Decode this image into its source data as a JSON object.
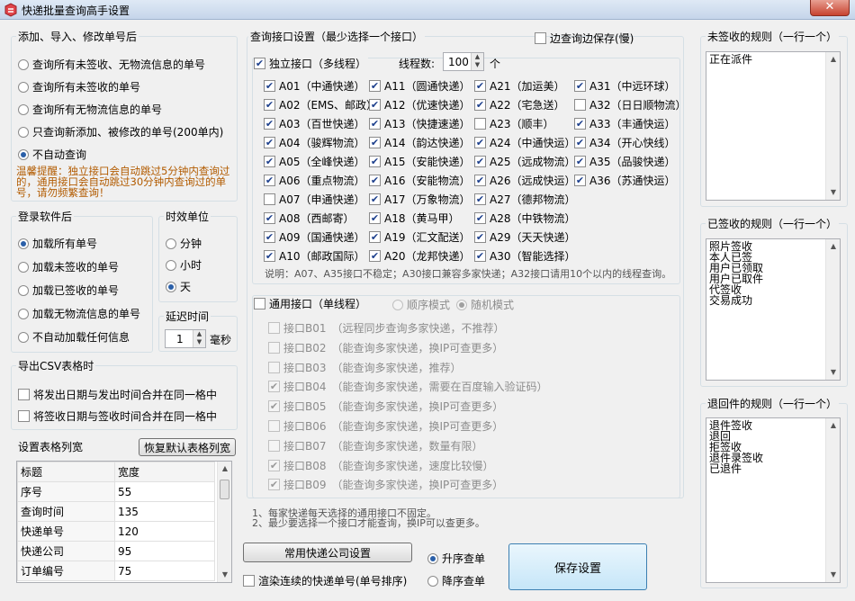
{
  "window": {
    "title": "快递批量查询高手设置",
    "close": "✕"
  },
  "add_group": {
    "title": "添加、导入、修改单号后",
    "options": [
      "查询所有未签收、无物流信息的单号",
      "查询所有未签收的单号",
      "查询所有无物流信息的单号",
      "只查询新添加、被修改的单号(200单内)",
      "不自动查询"
    ],
    "selected": 4,
    "warning": "温馨提醒：独立接口会自动跳过5分钟内查询过的，通用接口会自动跳过30分钟内查询过的单号，请勿频繁查询！"
  },
  "login_group": {
    "title": "登录软件后",
    "options": [
      "加载所有单号",
      "加载未签收的单号",
      "加载已签收的单号",
      "加载无物流信息的单号",
      "不自动加载任何信息"
    ],
    "selected": 0
  },
  "time_unit": {
    "title": "时效单位",
    "options": [
      "分钟",
      "小时",
      "天"
    ],
    "selected": 2
  },
  "delay": {
    "title": "延迟时间",
    "value": "1",
    "unit": "毫秒"
  },
  "csv_group": {
    "title": "导出CSV表格时",
    "options": [
      "将发出日期与发出时间合并在同一格中",
      "将签收日期与签收时间合并在同一格中"
    ]
  },
  "column_width": {
    "title": "设置表格列宽",
    "reset_button": "恢复默认表格列宽",
    "headers": [
      "标题",
      "宽度"
    ],
    "rows": [
      [
        "序号",
        "55"
      ],
      [
        "查询时间",
        "135"
      ],
      [
        "快递单号",
        "120"
      ],
      [
        "快递公司",
        "95"
      ],
      [
        "订单编号",
        "75"
      ]
    ]
  },
  "query_group": {
    "title": "查询接口设置（最少选择一个接口）",
    "save_while_query": "边查询边保存(慢)",
    "independent_label": "独立接口（多线程）",
    "thread_label": "线程数:",
    "thread_value": "100",
    "thread_unit": "个",
    "col1": [
      [
        "A01（中通快递）",
        true
      ],
      [
        "A02（EMS、邮政）",
        true
      ],
      [
        "A03（百世快递）",
        true
      ],
      [
        "A04（骏辉物流）",
        true
      ],
      [
        "A05（全峰快递）",
        true
      ],
      [
        "A06（重点物流）",
        true
      ],
      [
        "A07（申通快递）",
        false
      ],
      [
        "A08（西邮寄）",
        true
      ],
      [
        "A09（国通快递）",
        true
      ],
      [
        "A10（邮政国际）",
        true
      ]
    ],
    "col2": [
      [
        "A11（圆通快递）",
        true
      ],
      [
        "A12（优速快递）",
        true
      ],
      [
        "A13（快捷速递）",
        true
      ],
      [
        "A14（韵达快递）",
        true
      ],
      [
        "A15（安能快递）",
        true
      ],
      [
        "A16（安能物流）",
        true
      ],
      [
        "A17（万象物流）",
        true
      ],
      [
        "A18（黄马甲）",
        true
      ],
      [
        "A19（汇文配送）",
        true
      ],
      [
        "A20（龙邦快递）",
        true
      ]
    ],
    "col3": [
      [
        "A21（加运美）",
        true
      ],
      [
        "A22（宅急送）",
        true
      ],
      [
        "A23（顺丰）",
        false
      ],
      [
        "A24（中通快运）",
        true
      ],
      [
        "A25（远成物流）",
        true
      ],
      [
        "A26（远成快运）",
        true
      ],
      [
        "A27（德邦物流）",
        true
      ],
      [
        "A28（中铁物流）",
        true
      ],
      [
        "A29（天天快递）",
        true
      ],
      [
        "A30（智能选择）",
        true
      ]
    ],
    "col4": [
      [
        "A31（中远环球）",
        true
      ],
      [
        "A32（日日顺物流）",
        false
      ],
      [
        "A33（丰通快运）",
        true
      ],
      [
        "A34（开心快线）",
        true
      ],
      [
        "A35（品骏快递）",
        true
      ],
      [
        "A36（苏通快运）",
        true
      ]
    ],
    "note": "说明：A07、A35接口不稳定；A30接口兼容多家快递；A32接口请用10个以内的线程查询。",
    "general_label": "通用接口（单线程）",
    "mode_seq": "顺序模式",
    "mode_rand": "随机模式",
    "general_items": [
      [
        "接口B01",
        "（远程同步查询多家快递，不推荐）",
        false
      ],
      [
        "接口B02",
        "（能查询多家快递，换IP可查更多）",
        false
      ],
      [
        "接口B03",
        "（能查询多家快递，推荐）",
        false
      ],
      [
        "接口B04",
        "（能查询多家快递，需要在百度输入验证码）",
        true
      ],
      [
        "接口B05",
        "（能查询多家快递，换IP可查更多）",
        true
      ],
      [
        "接口B06",
        "（能查询多家快递，换IP可查更多）",
        false
      ],
      [
        "接口B07",
        "（能查询多家快递，数量有限）",
        false
      ],
      [
        "接口B08",
        "（能查询多家快递，速度比较慢）",
        true
      ],
      [
        "接口B09",
        "（能查询多家快递，换IP可查更多）",
        true
      ]
    ],
    "footnote1": "1、每家快递每天选择的通用接口不固定。",
    "footnote2": "2、最少要选择一个接口才能查询，换IP可以查更多。"
  },
  "bottom": {
    "common_button": "常用快递公司设置",
    "render_consecutive": "渲染连续的快递单号(单号排序)",
    "asc": "升序查单",
    "desc": "降序查单",
    "save": "保存设置"
  },
  "rules": {
    "unsigned_title": "未签收的规则（一行一个）",
    "unsigned": [
      "正在派件"
    ],
    "signed_title": "已签收的规则（一行一个）",
    "signed": [
      "照片签收",
      "本人已签",
      "用户已领取",
      "用户已取件",
      "代签收",
      "交易成功"
    ],
    "returned_title": "退回件的规则（一行一个）",
    "returned": [
      "退件签收",
      "退回",
      "拒签收",
      "退件录签收",
      "已退件"
    ]
  }
}
